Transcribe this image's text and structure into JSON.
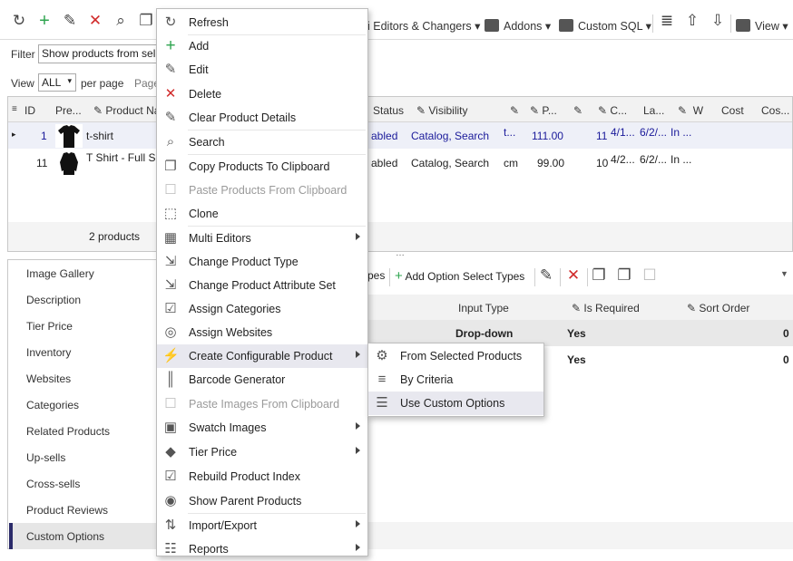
{
  "toolbar": {
    "menus": [
      "i Editors & Changers",
      "Addons",
      "Custom SQL",
      "View"
    ]
  },
  "filter": {
    "label": "Filter",
    "value": "Show products from sel"
  },
  "paging": {
    "view_label": "View",
    "view_value": "ALL",
    "per_page": "per page",
    "page_label": "Page"
  },
  "grid": {
    "headers": [
      "ID",
      "Pre...",
      "Product Na",
      "Status",
      "Visibility",
      "P...",
      "C...",
      "La...",
      "W",
      "Cost",
      "Cos..."
    ],
    "rows": [
      {
        "id": "1",
        "name": "t-shirt",
        "status": "abled",
        "visibility": "Catalog, Search",
        "col_t": "t...",
        "price": "111.00",
        "qty": "11",
        "date1": "4/1...",
        "date2": "6/2/...",
        "in": "In ..."
      },
      {
        "id": "11",
        "name": "T Shirt - Full Sle",
        "status": "abled",
        "visibility": "Catalog, Search",
        "col_t": "cm",
        "price": "99.00",
        "qty": "10",
        "date1": "4/2...",
        "date2": "6/2/...",
        "in": "In ..."
      }
    ],
    "footer": "2 products"
  },
  "sidebar": {
    "items": [
      "Image Gallery",
      "Description",
      "Tier Price",
      "Inventory",
      "Websites",
      "Categories",
      "Related Products",
      "Up-sells",
      "Cross-sells",
      "Product Reviews",
      "Custom Options"
    ]
  },
  "options": {
    "toolbar": {
      "types_tail": "pes",
      "add_select": "Add Option Select Types"
    },
    "headers": [
      "Input Type",
      "Is Required",
      "Sort Order"
    ],
    "rows": [
      {
        "input_type": "Drop-down",
        "required": "Yes",
        "sort": "0"
      },
      {
        "input_type": "",
        "required": "Yes",
        "sort": "0"
      }
    ]
  },
  "context_menu": {
    "items": [
      {
        "label": "Refresh",
        "icon": "refresh-icon"
      },
      {
        "label": "Add",
        "icon": "plus-icon"
      },
      {
        "label": "Edit",
        "icon": "pencil-icon"
      },
      {
        "label": "Delete",
        "icon": "delete-x-icon"
      },
      {
        "label": "Clear Product Details",
        "icon": "eraser-icon"
      },
      {
        "label": "Search",
        "icon": "search-icon"
      },
      {
        "label": "Copy Products To Clipboard",
        "icon": "copy-icon"
      },
      {
        "label": "Paste Products From Clipboard",
        "icon": "paste-icon"
      },
      {
        "label": "Clone",
        "icon": "clone-icon"
      },
      {
        "label": "Multi Editors",
        "icon": "multi-edit-icon"
      },
      {
        "label": "Change Product Type",
        "icon": "change-type-icon"
      },
      {
        "label": "Change Product Attribute Set",
        "icon": "attribute-set-icon"
      },
      {
        "label": "Assign Categories",
        "icon": "categories-icon"
      },
      {
        "label": "Assign Websites",
        "icon": "globe-icon"
      },
      {
        "label": "Create Configurable Product",
        "icon": "lightning-icon"
      },
      {
        "label": "Barcode Generator",
        "icon": "barcode-icon"
      },
      {
        "label": "Paste Images From Clipboard",
        "icon": "paste-image-icon"
      },
      {
        "label": "Swatch Images",
        "icon": "swatch-icon"
      },
      {
        "label": "Tier Price",
        "icon": "tag-icon"
      },
      {
        "label": "Rebuild Product Index",
        "icon": "rebuild-icon"
      },
      {
        "label": "Show Parent Products",
        "icon": "eye-icon"
      },
      {
        "label": "Import/Export",
        "icon": "import-export-icon"
      },
      {
        "label": "Reports",
        "icon": "reports-icon"
      }
    ]
  },
  "submenu": {
    "items": [
      {
        "label": "From Selected Products",
        "icon": "from-selected-icon"
      },
      {
        "label": "By Criteria",
        "icon": "criteria-icon"
      },
      {
        "label": "Use Custom Options",
        "icon": "custom-options-icon"
      }
    ]
  },
  "colors": {
    "accent": "#2b2b6a",
    "delete": "#d12b2b",
    "add": "#2ea44f",
    "link": "#1a1a9a"
  }
}
